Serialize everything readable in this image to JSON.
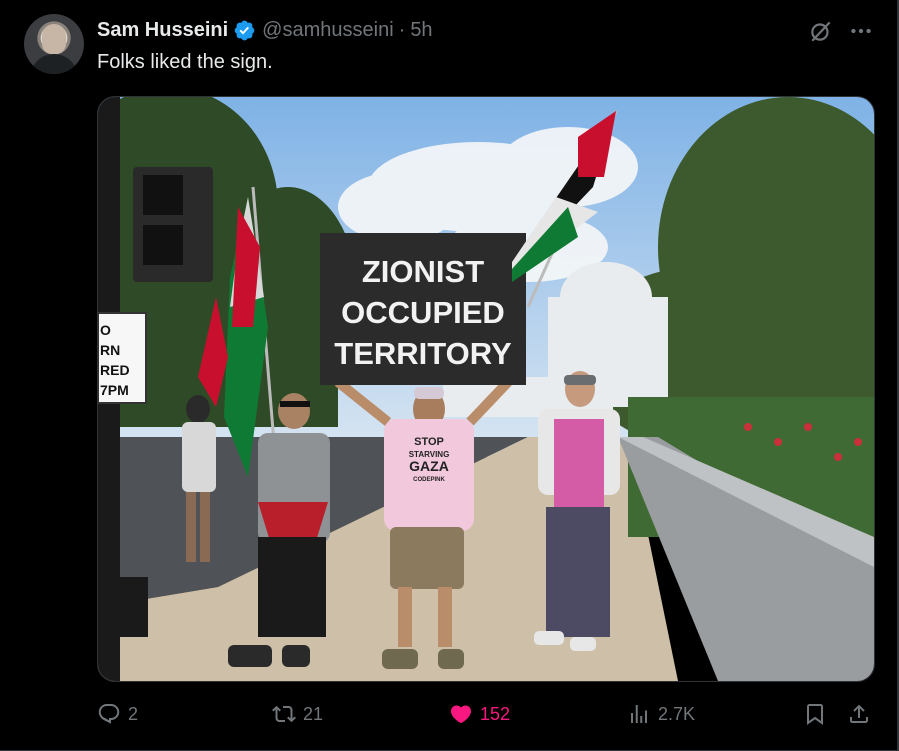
{
  "tweet": {
    "author_name": "Sam Husseini",
    "handle": "@samhusseini",
    "separator": "·",
    "time": "5h",
    "text": "Folks liked the sign.",
    "verified": true,
    "accent_color": "#1d9bf0",
    "like_color": "#f91880"
  },
  "media": {
    "sign_lines": [
      "ZIONIST",
      "OCCUPIED",
      "TERRITORY"
    ],
    "shirt_text_lines": [
      "STOP",
      "STARVING",
      "GAZA"
    ],
    "shirt_small_text": "CODEPINK",
    "street_sign_lines": [
      "O",
      "RN",
      "RED",
      "7PM"
    ]
  },
  "actions": {
    "replies": "2",
    "reposts": "21",
    "likes": "152",
    "views": "2.7K"
  },
  "icons": {
    "verified": "verified-badge-icon",
    "grok": "grok-icon",
    "more": "more-icon",
    "reply": "reply-icon",
    "repost": "repost-icon",
    "like": "heart-icon",
    "views": "views-icon",
    "bookmark": "bookmark-icon",
    "share": "share-icon"
  }
}
